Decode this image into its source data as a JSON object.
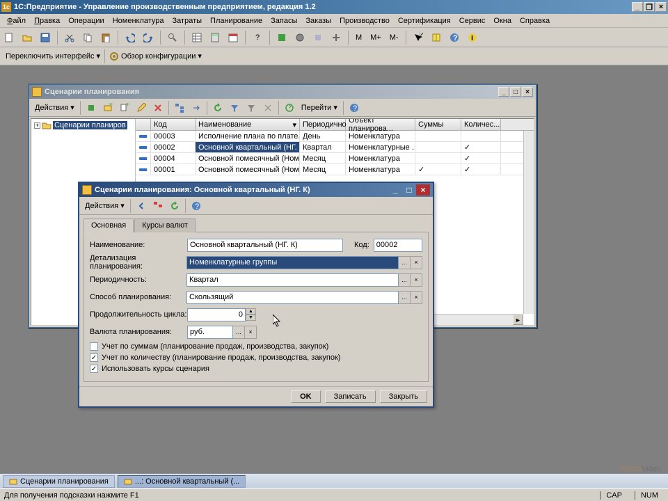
{
  "app": {
    "title": "1С:Предприятие - Управление производственным предприятием, редакция 1.2"
  },
  "menubar": [
    "Файл",
    "Правка",
    "Операции",
    "Номенклатура",
    "Затраты",
    "Планирование",
    "Запасы",
    "Заказы",
    "Производство",
    "Сертификация",
    "Сервис",
    "Окна",
    "Справка"
  ],
  "toolbar2": {
    "switch_iface": "Переключить интерфейс",
    "config_view": "Обзор конфигурации"
  },
  "list_window": {
    "title": "Сценарии планирования",
    "actions": "Действия",
    "go_to": "Перейти",
    "tree_root": "Сценарии планиров",
    "columns": [
      "",
      "Код",
      "Наименование",
      "Периодично...",
      "Объект планирова...",
      "Суммы",
      "Количес..."
    ],
    "rows": [
      {
        "code": "00003",
        "name": "Исполнение плана по плате...",
        "period": "День",
        "obj": "Номенклатура",
        "sums": false,
        "qty": false
      },
      {
        "code": "00002",
        "name": "Основной квартальный (НГ. К)",
        "period": "Квартал",
        "obj": "Номенклатурные ...",
        "sums": false,
        "qty": true,
        "selected": true
      },
      {
        "code": "00004",
        "name": "Основной помесячный (Ном...",
        "period": "Месяц",
        "obj": "Номенклатура",
        "sums": false,
        "qty": true
      },
      {
        "code": "00001",
        "name": "Основной помесячный (Ном...",
        "period": "Месяц",
        "obj": "Номенклатура",
        "sums": true,
        "qty": true
      }
    ]
  },
  "dialog": {
    "title": "Сценарии планирования: Основной квартальный (НГ. К)",
    "actions": "Действия",
    "tab_main": "Основная",
    "tab_rates": "Курсы валют",
    "lbl_name": "Наименование:",
    "val_name": "Основной квартальный (НГ. К)",
    "lbl_code": "Код:",
    "val_code": "00002",
    "lbl_detail": "Детализация планирования:",
    "val_detail": "Номенклатурные группы",
    "lbl_period": "Периодичность:",
    "val_period": "Квартал",
    "lbl_method": "Способ планирования:",
    "val_method": "Скользящий",
    "lbl_cycle": "Продолжительность цикла:",
    "val_cycle": "0",
    "lbl_currency": "Валюта планирования:",
    "val_currency": "руб.",
    "chk_sums": "Учет по суммам (планирование продаж, производства, закупок)",
    "chk_qty": "Учет по количеству (планирование продаж, производства, закупок)",
    "chk_rates": "Использовать курсы сценария",
    "btn_ok": "OK",
    "btn_save": "Записать",
    "btn_close": "Закрыть"
  },
  "taskbar": {
    "item1": "Сценарии планирования",
    "item2": "...: Основной квартальный (..."
  },
  "statusbar": {
    "hint": "Для получения подсказки нажмите F1",
    "cap": "CAP",
    "num": "NUM"
  },
  "watermark": {
    "a": "Teach",
    "b": "Video"
  }
}
